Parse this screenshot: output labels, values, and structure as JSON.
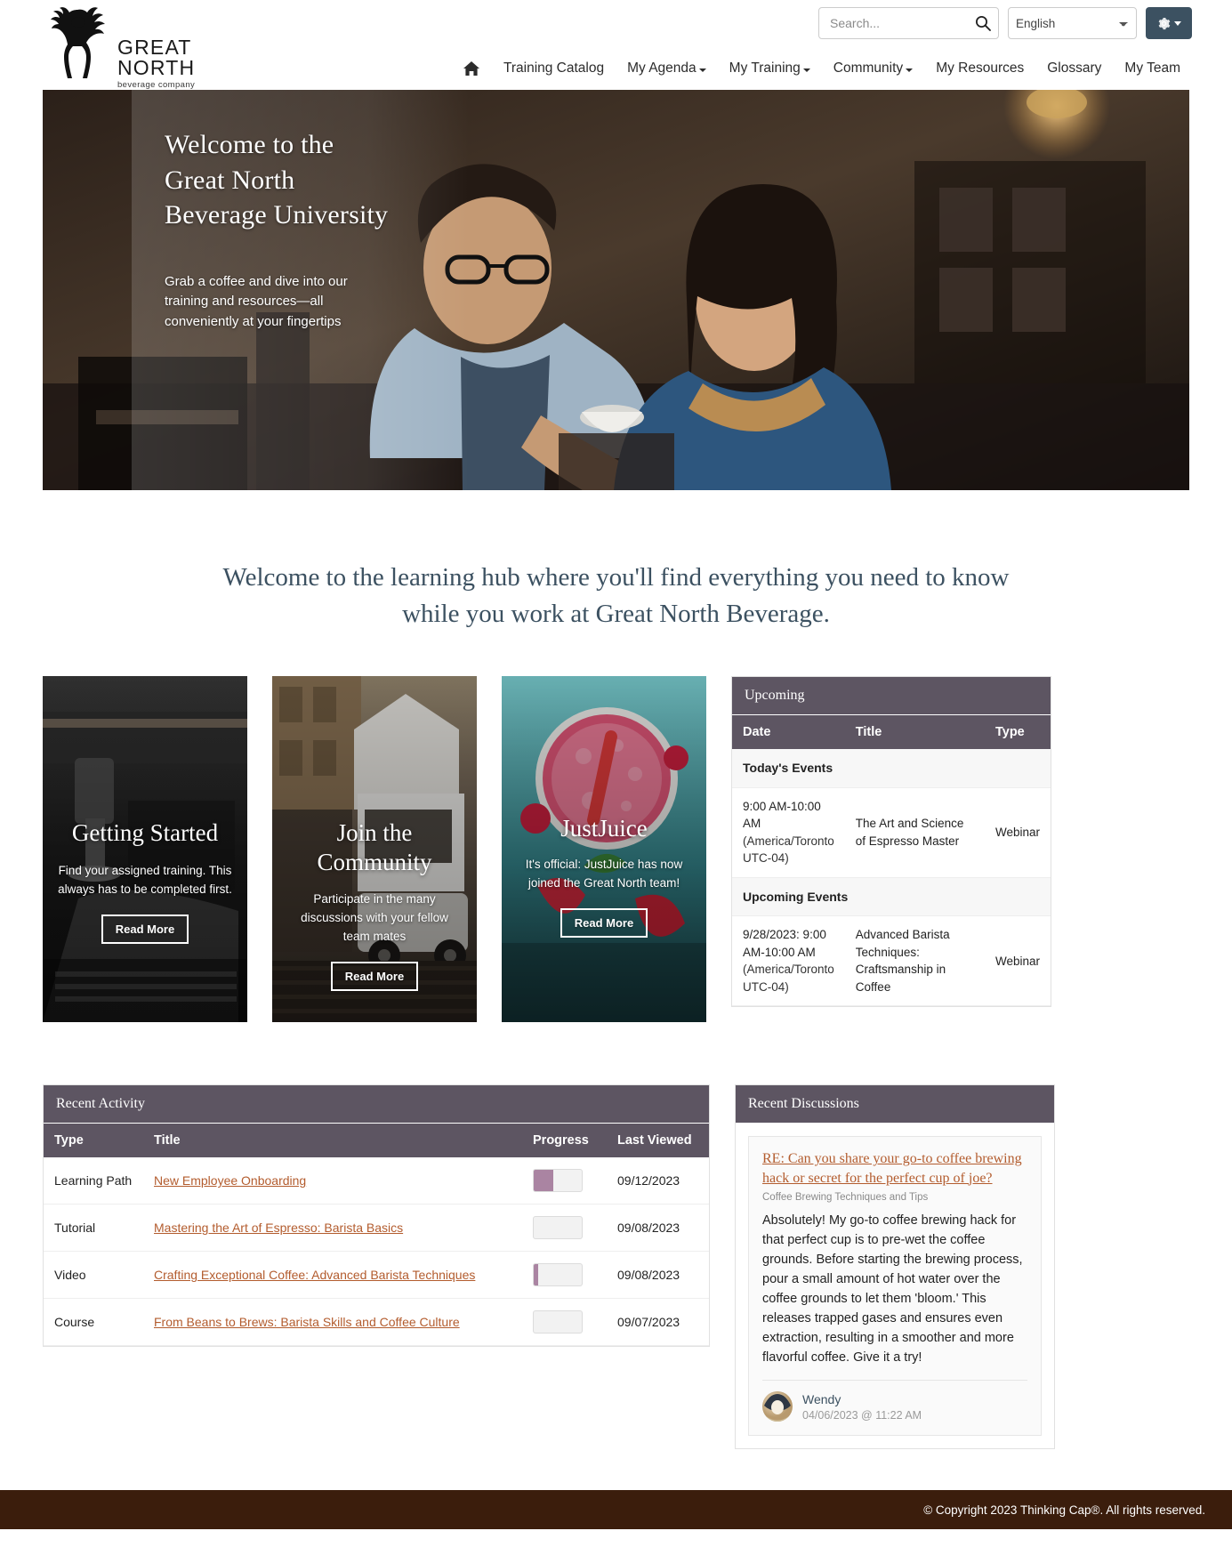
{
  "brand": {
    "name": "GREAT NORTH",
    "tagline": "beverage company",
    "logo_icon": "moose-icon"
  },
  "header": {
    "search": {
      "placeholder": "Search...",
      "value": "",
      "icon": "search-icon"
    },
    "language": {
      "selected": "English",
      "options": [
        "English"
      ]
    },
    "settings_icon": "gear-icon"
  },
  "nav": {
    "home_icon": "home-icon",
    "items": [
      {
        "label": "Training Catalog",
        "caret": false
      },
      {
        "label": "My Agenda",
        "caret": true
      },
      {
        "label": "My Training",
        "caret": true
      },
      {
        "label": "Community",
        "caret": true
      },
      {
        "label": "My Resources",
        "caret": false
      },
      {
        "label": "Glossary",
        "caret": false
      },
      {
        "label": "My Team",
        "caret": false
      }
    ]
  },
  "hero": {
    "title_line1": "Welcome to the",
    "title_line2": "Great North",
    "title_line3": "Beverage University",
    "subtitle": "Grab a coffee and dive into our training and resources—all conveniently at your fingertips"
  },
  "welcome_heading": "Welcome to the learning hub where you'll find everything you need to know while you work at Great North Beverage.",
  "cards": [
    {
      "id": "getting-started",
      "title": "Getting Started",
      "description": "Find your assigned training. This always has to be completed first.",
      "button": "Read More"
    },
    {
      "id": "join-the-community",
      "title": "Join the Community",
      "description": "Participate in the many discussions with your fellow team mates",
      "button": "Read More"
    },
    {
      "id": "justjuice",
      "title": "JustJuice",
      "description": "It's official: JustJuice has now joined the Great North team!",
      "button": "Read More"
    }
  ],
  "upcoming": {
    "panel_title": "Upcoming",
    "columns": [
      "Date",
      "Title",
      "Type"
    ],
    "groups": [
      {
        "label": "Today's Events",
        "rows": [
          {
            "date": "9:00 AM-10:00 AM",
            "timezone": "(America/Toronto UTC-04)",
            "title": "The Art and Science of Espresso Master",
            "type": "Webinar"
          }
        ]
      },
      {
        "label": "Upcoming Events",
        "rows": [
          {
            "date": "9/28/2023: 9:00 AM-10:00 AM",
            "timezone": "(America/Toronto UTC-04)",
            "title": "Advanced Barista Techniques: Craftsmanship in Coffee",
            "type": "Webinar"
          }
        ]
      }
    ]
  },
  "recent_activity": {
    "panel_title": "Recent Activity",
    "columns": [
      "Type",
      "Title",
      "Progress",
      "Last Viewed"
    ],
    "rows": [
      {
        "type": "Learning Path",
        "title": "New Employee Onboarding",
        "progress": 40,
        "last_viewed": "09/12/2023"
      },
      {
        "type": "Tutorial",
        "title": "Mastering the Art of Espresso: Barista Basics",
        "progress": 0,
        "last_viewed": "09/08/2023"
      },
      {
        "type": "Video",
        "title": "Crafting Exceptional Coffee: Advanced Barista Techniques",
        "progress": 10,
        "last_viewed": "09/08/2023"
      },
      {
        "type": "Course",
        "title": "From Beans to Brews: Barista Skills and Coffee Culture",
        "progress": 0,
        "last_viewed": "09/07/2023"
      }
    ]
  },
  "recent_discussions": {
    "panel_title": "Recent Discussions",
    "post": {
      "title": "RE: Can you share your go-to coffee brewing hack or secret for the perfect cup of joe?",
      "category": "Coffee Brewing Techniques and Tips",
      "body": "Absolutely! My go-to coffee brewing hack for that perfect cup is to pre-wet the coffee grounds. Before starting the brewing process, pour a small amount of hot water over the coffee grounds to let them 'bloom.' This releases trapped gases and ensures even extraction, resulting in a smoother and more flavorful coffee. Give it a try!",
      "author": "Wendy",
      "timestamp": "04/06/2023 @ 11:22 AM",
      "avatar_icon": "user-avatar"
    }
  },
  "footer": {
    "copyright": "© Copyright 2023 Thinking Cap®. All rights reserved."
  },
  "colors": {
    "panel_header": "#5d5562",
    "link": "#b35c2e",
    "heading": "#3c5161",
    "footer_bg": "#3b1d0c",
    "progress_fill": "#aa84a2"
  }
}
